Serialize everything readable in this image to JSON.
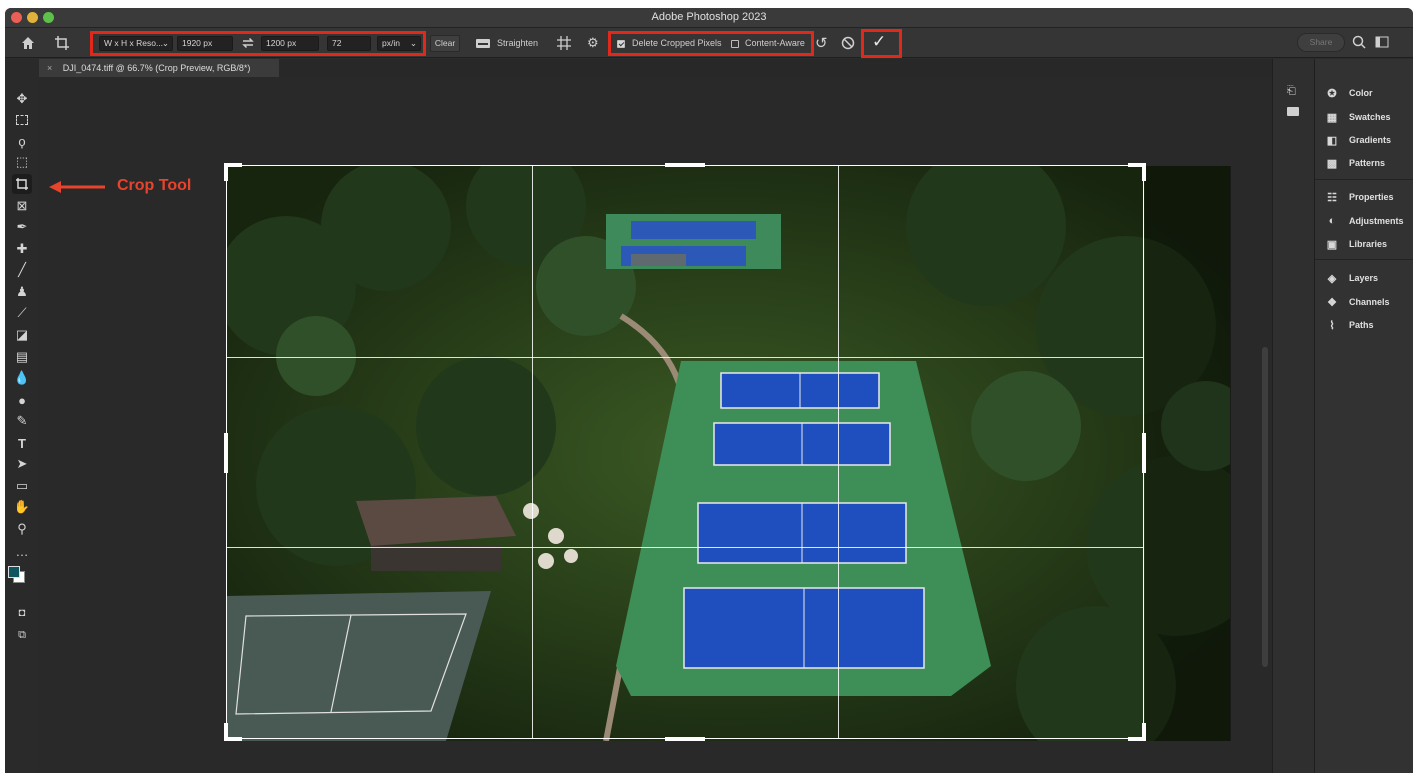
{
  "app": {
    "title": "Adobe Photoshop 2023"
  },
  "options_bar": {
    "ratio_preset": "W x H x Reso...",
    "width": "1920 px",
    "height": "1200 px",
    "resolution": "72",
    "resolution_unit": "px/in",
    "clear_label": "Clear",
    "straighten_label": "Straighten",
    "delete_cropped_label": "Delete Cropped Pixels",
    "delete_cropped_checked": true,
    "content_aware_label": "Content-Aware",
    "content_aware_checked": false,
    "share_label": "Share"
  },
  "document": {
    "tab_label": "DJI_0474.tiff @ 66.7% (Crop Preview, RGB/8*)"
  },
  "annotation": {
    "label": "Crop Tool",
    "color": "#e8432c"
  },
  "tools": [
    "move",
    "marquee",
    "lasso",
    "object-select",
    "crop",
    "frame",
    "eyedropper",
    "healing",
    "brush",
    "stamp",
    "history-brush",
    "eraser",
    "gradient",
    "blur",
    "dodge",
    "pen",
    "type",
    "path-select",
    "rectangle",
    "hand",
    "zoom",
    "more"
  ],
  "panels": {
    "group1": [
      "Color",
      "Swatches",
      "Gradients",
      "Patterns"
    ],
    "group2": [
      "Properties",
      "Adjustments",
      "Libraries"
    ],
    "group3": [
      "Layers",
      "Channels",
      "Paths"
    ]
  },
  "colors": {
    "highlight_box": "#e0291a",
    "foreground_swatch": "#0e5560",
    "background_swatch": "#ffffff"
  }
}
